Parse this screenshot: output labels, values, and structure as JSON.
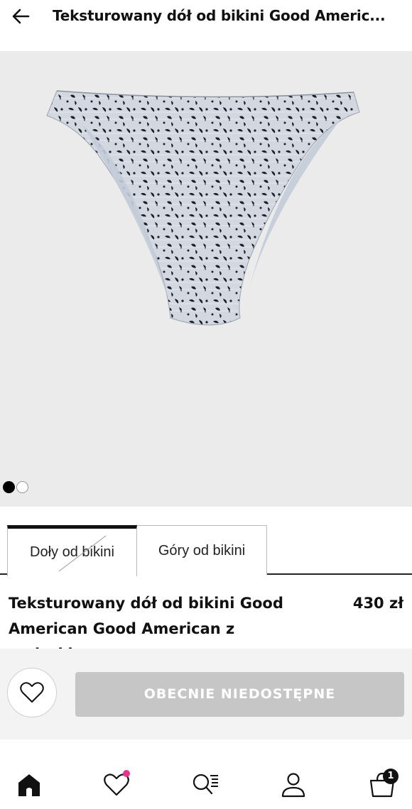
{
  "header": {
    "title": "Teksturowany dół od bikini Good Americ...",
    "back_icon": "arrow-left-icon"
  },
  "gallery": {
    "image_subject": "",
    "pagination": {
      "current_page": 1,
      "total_pages": 2
    }
  },
  "tabs": [
    {
      "label": "Doły od bikini",
      "selected": true
    },
    {
      "label": "Góry od bikini",
      "selected": false
    }
  ],
  "product": {
    "name": "Teksturowany dół od bikini Good American Good American z nadruki...",
    "price": "430 zł"
  },
  "actions": {
    "favorite_icon": "heart-icon",
    "unavailable_label": "OBECNIE NIEDOSTĘPNE",
    "unavailable_color": "#c6c6c6"
  },
  "bottom_nav": {
    "items": [
      {
        "icon": "home-icon",
        "active": true
      },
      {
        "icon": "heart-icon",
        "has_notification": true
      },
      {
        "icon": "search-list-icon"
      },
      {
        "icon": "user-icon"
      },
      {
        "icon": "bag-icon",
        "badge": "1"
      }
    ],
    "notification_color": "#e8348a"
  }
}
